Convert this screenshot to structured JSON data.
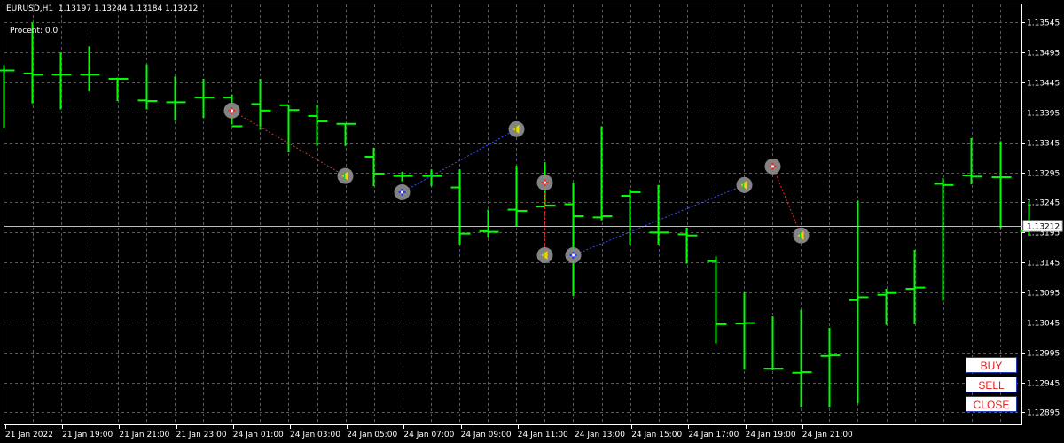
{
  "header": {
    "symbol": "EURUSD,H1",
    "ohlc": "1.13197 1.13244 1.13184 1.13212",
    "procent": "Procent: 0.0"
  },
  "current_price_label": "1.13212",
  "buttons": {
    "buy": "BUY",
    "sell": "SELL",
    "close": "CLOSE"
  },
  "colors": {
    "background": "#000000",
    "grid": "#5a5a5a",
    "bar": "#00ff00",
    "sell_line": "#ff2020",
    "buy_line": "#3c50ff"
  },
  "chart_data": {
    "type": "ohlc",
    "ylim": [
      1.12875,
      1.13575
    ],
    "y_ticks": [
      "1.13545",
      "1.13495",
      "1.13445",
      "1.13395",
      "1.13345",
      "1.13295",
      "1.13245",
      "1.13195",
      "1.13145",
      "1.13095",
      "1.13045",
      "1.12995",
      "1.12945",
      "1.12895"
    ],
    "x_ticks": [
      "21 Jan 2022",
      "21 Jan 19:00",
      "21 Jan 21:00",
      "21 Jan 23:00",
      "24 Jan 01:00",
      "24 Jan 03:00",
      "24 Jan 05:00",
      "24 Jan 07:00",
      "24 Jan 09:00",
      "24 Jan 11:00",
      "24 Jan 13:00",
      "24 Jan 15:00",
      "24 Jan 17:00",
      "24 Jan 19:00",
      "24 Jan 21:00"
    ],
    "bars": [
      {
        "h": 1.13474,
        "l": 1.13369,
        "o": 1.13465,
        "c": 1.13465
      },
      {
        "h": 1.13545,
        "l": 1.1341,
        "o": 1.1346,
        "c": 1.13458
      },
      {
        "h": 1.13495,
        "l": 1.134,
        "o": 1.13458,
        "c": 1.13458
      },
      {
        "h": 1.13505,
        "l": 1.1343,
        "o": 1.13458,
        "c": 1.13458
      },
      {
        "h": 1.13453,
        "l": 1.13414,
        "o": 1.13451,
        "c": 1.13451
      },
      {
        "h": 1.13475,
        "l": 1.134,
        "o": 1.13415,
        "c": 1.13414
      },
      {
        "h": 1.13455,
        "l": 1.13381,
        "o": 1.13412,
        "c": 1.13412
      },
      {
        "h": 1.13451,
        "l": 1.13386,
        "o": 1.1342,
        "c": 1.1342
      },
      {
        "h": 1.13425,
        "l": 1.13375,
        "o": 1.1342,
        "c": 1.13372
      },
      {
        "h": 1.13451,
        "l": 1.13366,
        "o": 1.13409,
        "c": 1.13398
      },
      {
        "h": 1.13407,
        "l": 1.13329,
        "o": 1.13407,
        "c": 1.13399
      },
      {
        "h": 1.13408,
        "l": 1.13339,
        "o": 1.13389,
        "c": 1.1338
      },
      {
        "h": 1.13376,
        "l": 1.13339,
        "o": 1.13376,
        "c": 1.13376
      },
      {
        "h": 1.13336,
        "l": 1.13272,
        "o": 1.13321,
        "c": 1.13293
      },
      {
        "h": 1.13296,
        "l": 1.1328,
        "o": 1.13289,
        "c": 1.13289
      },
      {
        "h": 1.133,
        "l": 1.13272,
        "o": 1.13289,
        "c": 1.13289
      },
      {
        "h": 1.133,
        "l": 1.13175,
        "o": 1.1327,
        "c": 1.13193
      },
      {
        "h": 1.13233,
        "l": 1.13186,
        "o": 1.13197,
        "c": 1.13196
      },
      {
        "h": 1.13306,
        "l": 1.13205,
        "o": 1.13233,
        "c": 1.13231
      },
      {
        "h": 1.13312,
        "l": 1.1324,
        "o": 1.13238,
        "c": 1.1324
      },
      {
        "h": 1.13278,
        "l": 1.13089,
        "o": 1.13242,
        "c": 1.13222
      },
      {
        "h": 1.13372,
        "l": 1.13215,
        "o": 1.1322,
        "c": 1.13222
      },
      {
        "h": 1.13267,
        "l": 1.13174,
        "o": 1.13256,
        "c": 1.13262
      },
      {
        "h": 1.13274,
        "l": 1.13175,
        "o": 1.13195,
        "c": 1.13195
      },
      {
        "h": 1.13203,
        "l": 1.13143,
        "o": 1.13192,
        "c": 1.1319
      },
      {
        "h": 1.13155,
        "l": 1.1301,
        "o": 1.13147,
        "c": 1.13042
      },
      {
        "h": 1.13095,
        "l": 1.12966,
        "o": 1.13043,
        "c": 1.13044
      },
      {
        "h": 1.13055,
        "l": 1.12965,
        "o": 1.12968,
        "c": 1.12968
      },
      {
        "h": 1.13066,
        "l": 1.12904,
        "o": 1.12961,
        "c": 1.12962
      },
      {
        "h": 1.13036,
        "l": 1.12904,
        "o": 1.12989,
        "c": 1.1299
      },
      {
        "h": 1.13248,
        "l": 1.1291,
        "o": 1.13082,
        "c": 1.13087
      },
      {
        "h": 1.13101,
        "l": 1.13041,
        "o": 1.13091,
        "c": 1.13094
      },
      {
        "h": 1.13166,
        "l": 1.13042,
        "o": 1.13101,
        "c": 1.13103
      },
      {
        "h": 1.13286,
        "l": 1.13081,
        "o": 1.13276,
        "c": 1.13274
      },
      {
        "h": 1.13352,
        "l": 1.13275,
        "o": 1.1329,
        "c": 1.13288
      },
      {
        "h": 1.13347,
        "l": 1.13202,
        "o": 1.13287,
        "c": 1.13287
      },
      {
        "h": 1.13247,
        "l": 1.1319,
        "o": 1.13197,
        "c": 1.13212
      }
    ],
    "trades": [
      {
        "type": "sell",
        "open_bar": 8,
        "open_price": 1.13398,
        "close_bar": 12,
        "close_price": 1.13289
      },
      {
        "type": "buy",
        "open_bar": 14,
        "open_price": 1.13262,
        "close_bar": 18,
        "close_price": 1.13367
      },
      {
        "type": "sell",
        "open_bar": 19,
        "open_price": 1.13278,
        "close_bar": 19,
        "close_price": 1.13157
      },
      {
        "type": "buy",
        "open_bar": 20,
        "open_price": 1.13157,
        "close_bar": 26,
        "close_price": 1.13274
      },
      {
        "type": "sell",
        "open_bar": 27,
        "open_price": 1.13305,
        "close_bar": 28,
        "close_price": 1.1319
      }
    ]
  }
}
